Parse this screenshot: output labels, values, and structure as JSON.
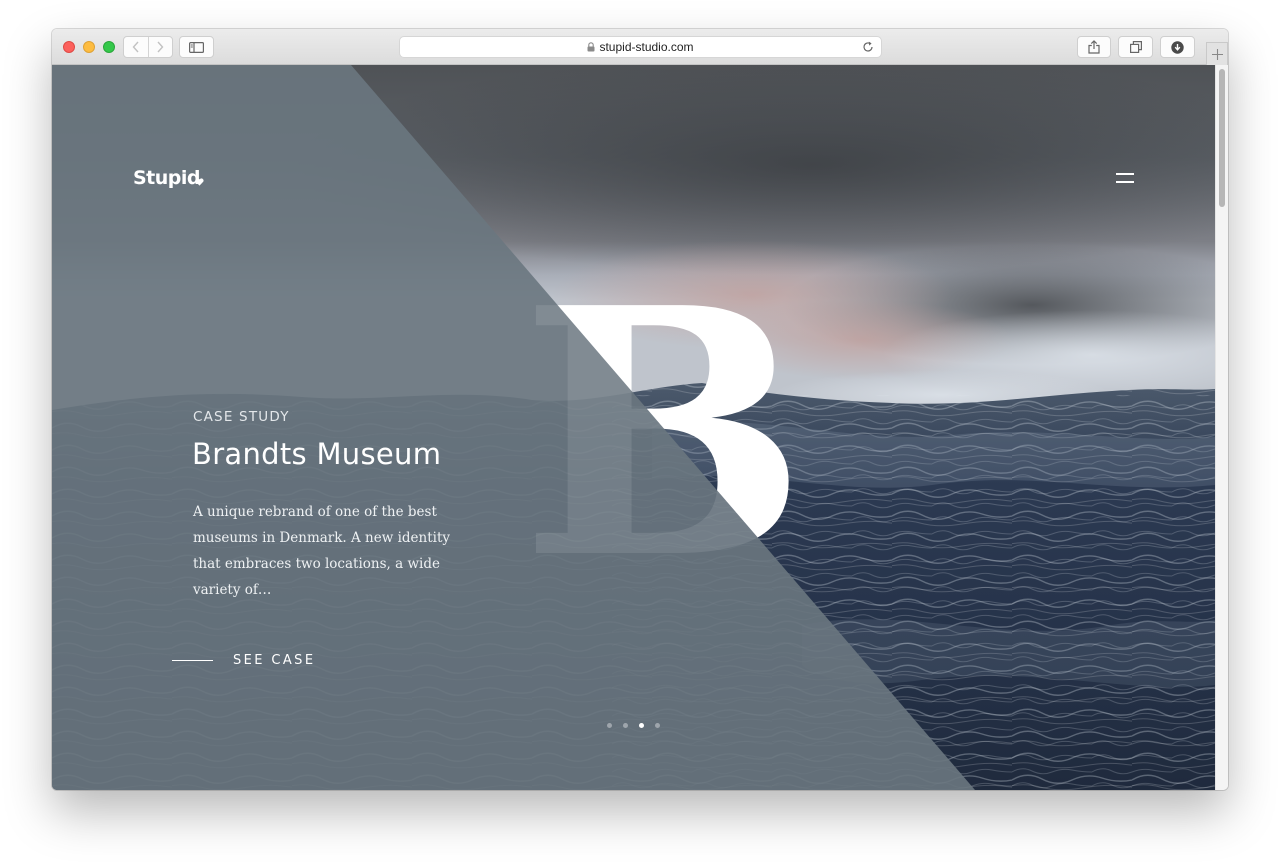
{
  "browser": {
    "url": "stupid-studio.com"
  },
  "site": {
    "logo_text": "Stupid"
  },
  "hero": {
    "kicker": "CASE STUDY",
    "title": "Brandts Museum",
    "description": "A unique rebrand of one of the best museums in Denmark. A new identity that embraces two locations, a wide variety of…",
    "cta_label": "SEE CASE",
    "monogram": "B"
  },
  "slider": {
    "slides": 4,
    "active_slide": 3
  },
  "colors": {
    "overlay": "#6a7780",
    "sky": "#595f66",
    "sea": "#25324a",
    "text": "#ffffff"
  },
  "icons": [
    "back-icon",
    "forward-icon",
    "sidebar-icon",
    "lock-icon",
    "reload-icon",
    "share-icon",
    "tabs-icon",
    "download-icon",
    "new-tab-icon",
    "logo-heart-icon",
    "hamburger-menu-icon"
  ]
}
